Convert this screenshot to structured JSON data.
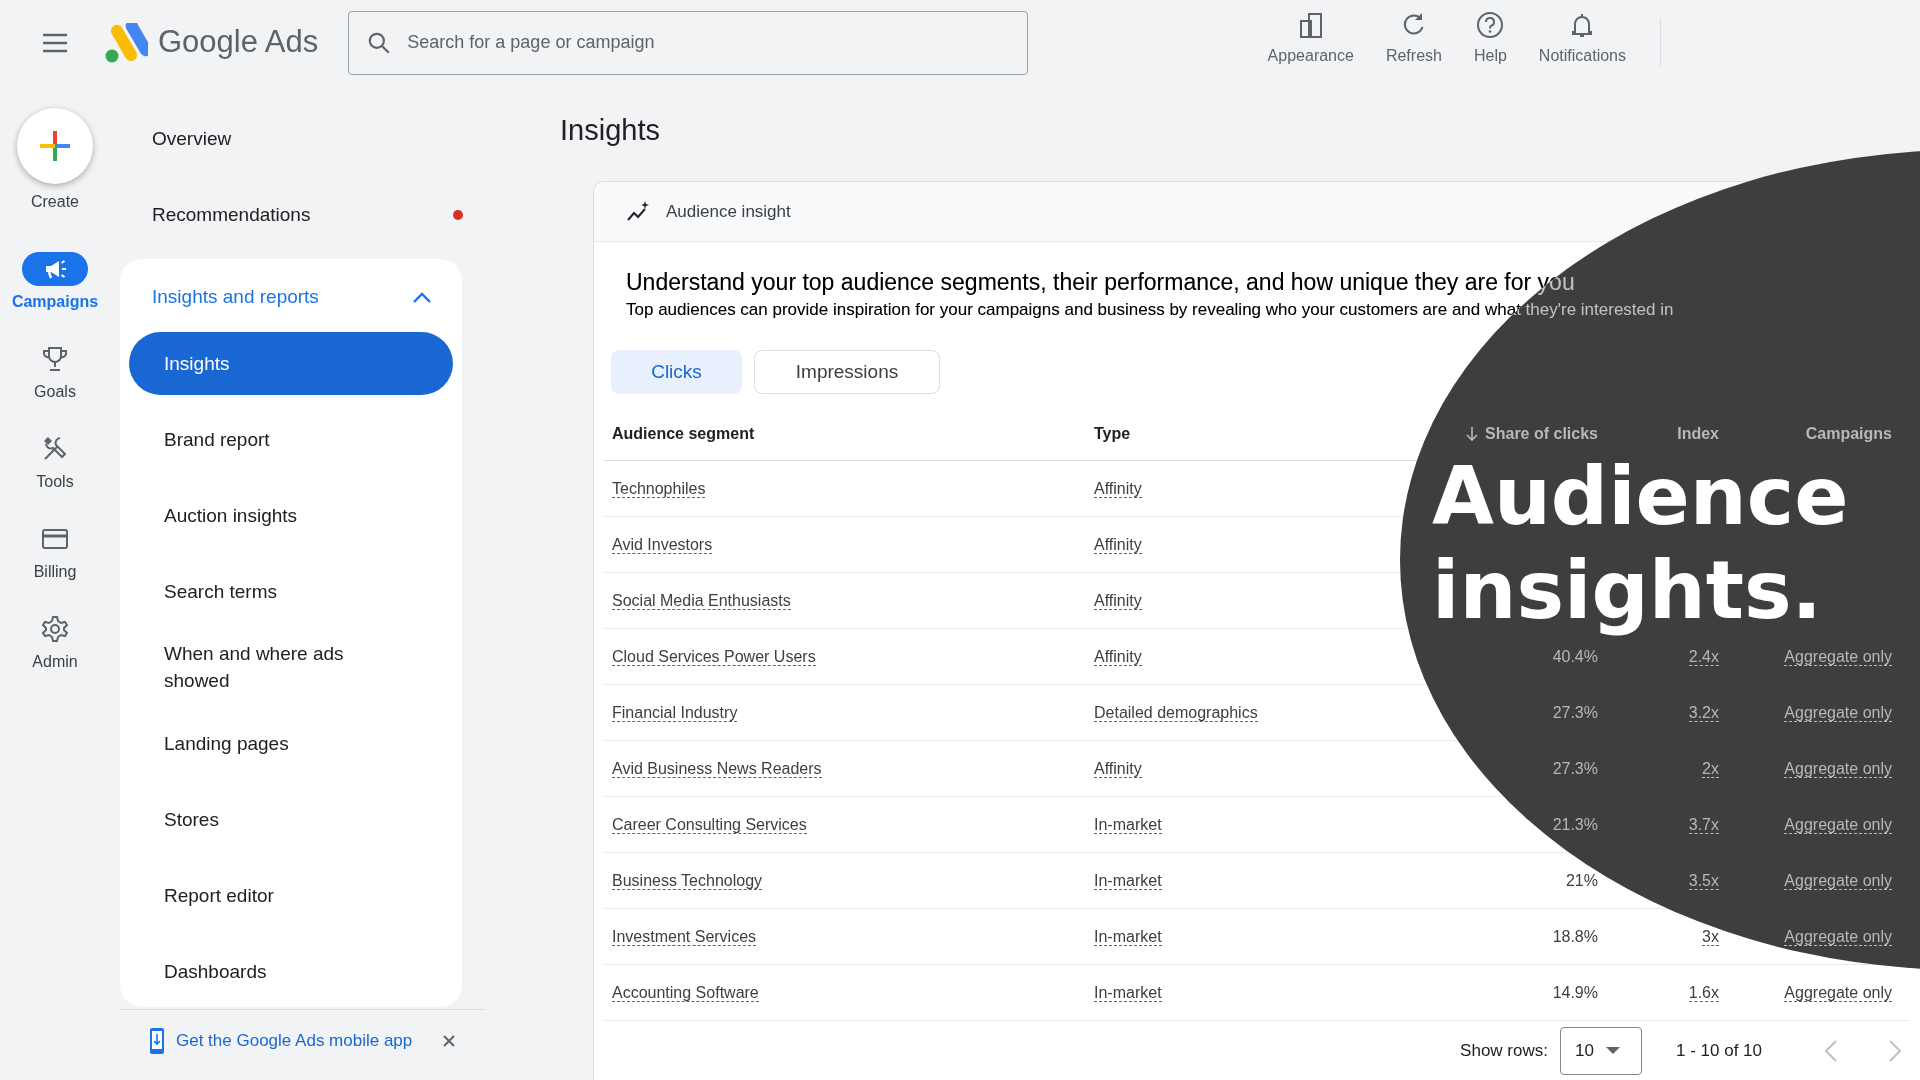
{
  "header": {
    "product": "Google Ads",
    "search_placeholder": "Search for a page or campaign"
  },
  "toolbar": [
    {
      "label": "Appearance"
    },
    {
      "label": "Refresh"
    },
    {
      "label": "Help"
    },
    {
      "label": "Notifications"
    }
  ],
  "rail": [
    {
      "label": "Create",
      "kind": "fab"
    },
    {
      "label": "Campaigns",
      "kind": "item",
      "selected": true
    },
    {
      "label": "Goals",
      "kind": "item",
      "selected": false
    },
    {
      "label": "Tools",
      "kind": "item",
      "selected": false
    },
    {
      "label": "Billing",
      "kind": "item",
      "selected": false
    },
    {
      "label": "Admin",
      "kind": "item",
      "selected": false
    }
  ],
  "nav": {
    "items": [
      {
        "label": "Overview",
        "alert": false
      },
      {
        "label": "Recommendations",
        "alert": true
      }
    ],
    "section": {
      "label": "Insights and reports",
      "expanded": true,
      "children": [
        {
          "label": "Insights",
          "selected": true
        },
        {
          "label": "Brand report",
          "selected": false
        },
        {
          "label": "Auction insights",
          "selected": false
        },
        {
          "label": "Search terms",
          "selected": false
        },
        {
          "label": "When and where ads showed",
          "selected": false
        },
        {
          "label": "Landing pages",
          "selected": false
        },
        {
          "label": "Stores",
          "selected": false
        },
        {
          "label": "Report editor",
          "selected": false
        },
        {
          "label": "Dashboards",
          "selected": false
        }
      ]
    },
    "promo": "Get the Google Ads mobile app"
  },
  "page_title": "Insights",
  "card": {
    "label": "Audience insight",
    "heading": "Understand your top audience segments, their performance, and how unique they are for you",
    "subheading": "Top audiences can provide inspiration for your campaigns and business by revealing who your customers are and what they're interested in",
    "tabs": [
      {
        "label": "Clicks",
        "selected": true
      },
      {
        "label": "Impressions",
        "selected": false
      }
    ],
    "columns": [
      "Audience segment",
      "Type",
      "Share of clicks",
      "Index",
      "Campaigns"
    ],
    "rows": [
      {
        "segment": "Technophiles",
        "type": "Affinity"
      },
      {
        "segment": "Avid Investors",
        "type": "Affinity"
      },
      {
        "segment": "Social Media Enthusiasts",
        "type": "Affinity"
      },
      {
        "segment": "Cloud Services Power Users",
        "type": "Affinity",
        "share": "40.4%",
        "index": "2.4x",
        "campaigns": "Aggregate only"
      },
      {
        "segment": "Financial Industry",
        "type": "Detailed demographics",
        "share": "27.3%",
        "index": "3.2x",
        "campaigns": "Aggregate only"
      },
      {
        "segment": "Avid Business News Readers",
        "type": "Affinity",
        "share": "27.3%",
        "index": "2x",
        "campaigns": "Aggregate only"
      },
      {
        "segment": "Career Consulting Services",
        "type": "In-market",
        "share": "21.3%",
        "index": "3.7x",
        "campaigns": "Aggregate only"
      },
      {
        "segment": "Business Technology",
        "type": "In-market",
        "share": "21%",
        "index": "3.5x",
        "campaigns": "Aggregate only"
      },
      {
        "segment": "Investment Services",
        "type": "In-market",
        "share": "18.8%",
        "index": "3x",
        "campaigns": "Aggregate only"
      },
      {
        "segment": "Accounting Software",
        "type": "In-market",
        "share": "14.9%",
        "index": "1.6x",
        "campaigns": "Aggregate only"
      }
    ],
    "pagination": {
      "label": "Show rows:",
      "rows_value": "10",
      "range": "1 - 10 of 10"
    }
  },
  "overlay": {
    "title": "Audience insights."
  }
}
